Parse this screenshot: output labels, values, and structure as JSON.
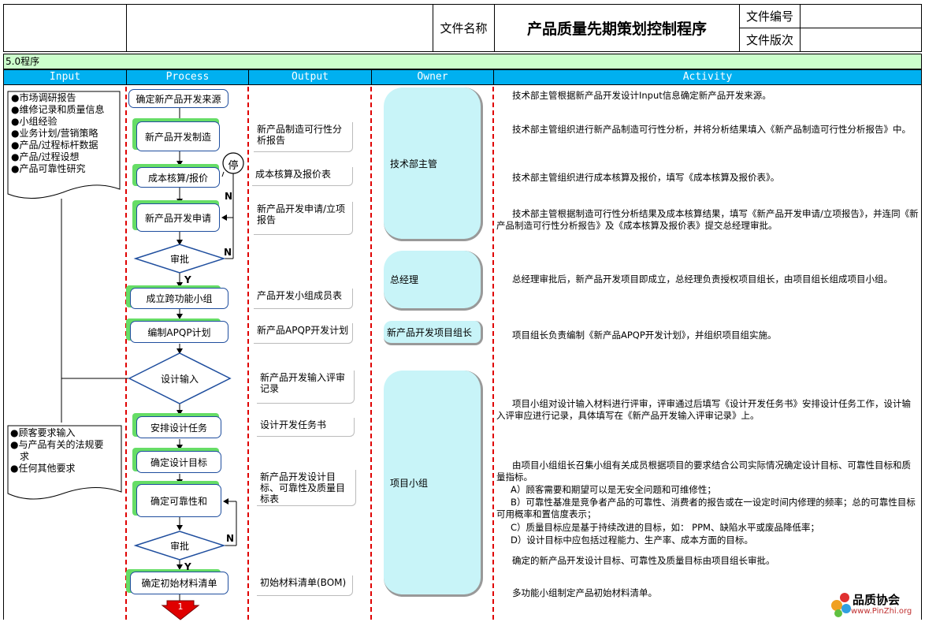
{
  "header": {
    "doc_name_label": "文件名称",
    "title": "产品质量先期策划控制程序",
    "doc_no_label": "文件编号",
    "doc_version_label": "文件版次"
  },
  "section": {
    "label": "5.0程序"
  },
  "columns": [
    "Input",
    "Process",
    "Output",
    "Owner",
    "Activity"
  ],
  "inputs": {
    "group1": [
      "●市场调研报告",
      "●维修记录和质量信息",
      "●小组经验",
      "●业务计划/营销策略",
      "●产品/过程标杆数据",
      "●产品/过程设想",
      "●产品可靠性研究"
    ],
    "group2": [
      "●顾客要求输入",
      "●与产品有关的法规要",
      "求",
      "●任何其他要求"
    ]
  },
  "process": {
    "step1": "确定新产品开发来源",
    "step2": "新产品开发制造",
    "step3": "成本核算/报价",
    "step4": "新产品开发申请",
    "review1": "审批",
    "step5": "成立跨功能小组",
    "step6": "编制APQP计划",
    "design_input": "设计输入",
    "step7": "安排设计任务",
    "step8": "确定设计目标",
    "step9": "确定可靠性和",
    "review2": "审批",
    "step10": "确定初始材料清单",
    "stop": "停",
    "label_n1": "N",
    "label_n2": "N",
    "label_y1": "Y",
    "label_n3": "N",
    "label_y2": "Y",
    "connector": "1"
  },
  "outputs": [
    "新产品制造可行性分析报告",
    "成本核算及报价表",
    "新产品开发申请/立项报告",
    "产品开发小组成员表",
    "新产品APQP开发计划",
    "新产品开发输入评审记录",
    "设计开发任务书",
    "新产品开发设计目标、可靠性及质量目标表",
    "初始材料清单(BOM)"
  ],
  "owners": [
    "技术部主管",
    "总经理",
    "新产品开发项目组长",
    "项目小组"
  ],
  "activities": [
    "技术部主管根据新产品开发设计Input信息确定新产品开发来源。",
    "技术部主管组织进行新产品制造可行性分析，并将分析结果填入《新产品制造可行性分析报告》中。",
    "技术部主管组织进行成本核算及报价，填写《成本核算及报价表》。",
    "技术部主管根据制造可行性分析结果及成本核算结果，填写《新产品开发申请/立项报告》，并连同《新产品制造可行性分析报告》及《成本核算及报价表》提交总经理审批。",
    "总经理审批后，新产品开发项目即成立，总经理负责授权项目组长，由项目组长组成项目小组。",
    "项目组长负责编制《新产品APQP开发计划》，并组织项目组实施。",
    "项目小组对设计输入材料进行评审，评审通过后填写《设计开发任务书》安排设计任务工作，设计输入评审应进行记录，具体填写在《新产品开发输入评审记录》上。",
    "由项目小组组长召集小组有关成员根据项目的要求结合公司实际情况确定设计目标、可靠性目标和质量指标。",
    "A）顾客需要和期望可以是无安全问题和可维修性；",
    "B）可靠性基准是竞争者产品的可靠性、消费者的报告或在一设定时间内修理的频率；总的可靠性目标可用概率和置信度表示；",
    "C）质量目标应是基于持续改进的目标，如： PPM、缺陷水平或废品降低率；",
    "D）设计目标中应包括过程能力、生产率、成本方面的目标。",
    "确定的新产品开发设计目标、可靠性及质量目标由项目组长审批。",
    "多功能小组制定产品初始材料清单。"
  ],
  "logo": {
    "name": "品质协会",
    "url": "www.PinZhi.org"
  },
  "colors": {
    "column_header": "#00b0f0",
    "section_band": "#ccffcc",
    "owner_fill": "#c8f4f8",
    "lane_divider": "#e00000",
    "node_border": "#1f4e9e",
    "node_shadow": "#66dd66"
  }
}
